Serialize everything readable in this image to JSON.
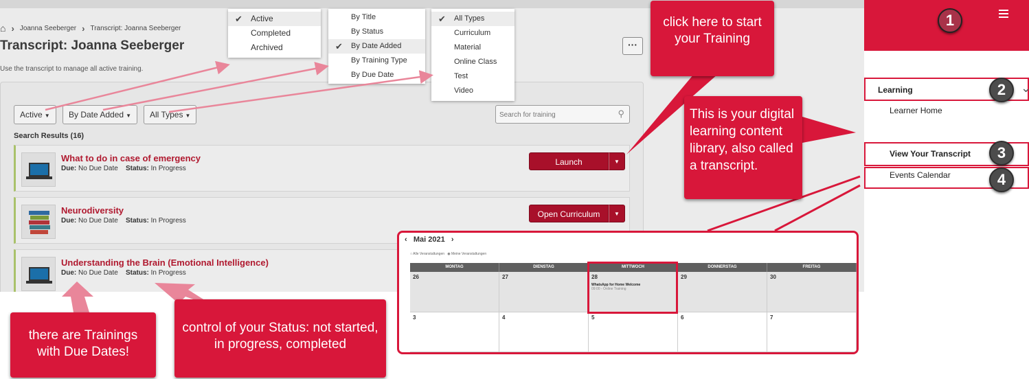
{
  "breadcrumb": {
    "user": "Joanna Seeberger",
    "current": "Transcript: Joanna Seeberger"
  },
  "page": {
    "title": "Transcript: Joanna Seeberger",
    "description": "Use the transcript to manage all active training.",
    "more_label": "···"
  },
  "filters": {
    "status": "Active",
    "sort": "By Date Added",
    "type": "All Types"
  },
  "search": {
    "placeholder": "Search for training"
  },
  "results_title": "Search Results (16)",
  "trainings": [
    {
      "title": "What to do in case of emergency",
      "due_label": "Due:",
      "due": "No Due Date",
      "status_label": "Status:",
      "status": "In Progress",
      "action": "Launch"
    },
    {
      "title": "Neurodiversity",
      "due_label": "Due:",
      "due": "No Due Date",
      "status_label": "Status:",
      "status": "In Progress",
      "action": "Open Curriculum"
    },
    {
      "title": "Understanding the Brain (Emotional Intelligence)",
      "due_label": "Due:",
      "due": "No Due Date",
      "status_label": "Status:",
      "status": "In Progress"
    }
  ],
  "status_menu": {
    "items": [
      "Active",
      "Completed",
      "Archived"
    ],
    "selected": "Active"
  },
  "sort_menu": {
    "items": [
      "By Title",
      "By Status",
      "By Date Added",
      "By Training Type",
      "By Due Date"
    ],
    "selected": "By Date Added"
  },
  "type_menu": {
    "items": [
      "All Types",
      "Curriculum",
      "Material",
      "Online Class",
      "Test",
      "Video"
    ],
    "selected": "All Types"
  },
  "callouts": {
    "launch": "click here to start your Training",
    "library": "This is your digital learning content library, also called a transcript.",
    "due_dates": "there are Trainings with Due Dates!",
    "status": "control of your Status: not started, in progress, completed"
  },
  "sidebar": {
    "badges": [
      "1",
      "2",
      "3",
      "4"
    ],
    "learning": "Learning",
    "learner_home": "Learner Home",
    "view_transcript": "View Your Transcript",
    "events_calendar": "Events Calendar"
  },
  "calendar": {
    "month": "Mai 2021",
    "prev": "‹",
    "next": "›",
    "filter_all": "Alle Veranstaltungen",
    "filter_mine": "Meine Veranstaltungen",
    "weekdays": [
      "MONTAG",
      "DIENSTAG",
      "MITTWOCH",
      "DONNERSTAG",
      "FREITAG"
    ],
    "week1": [
      "26",
      "27",
      "28",
      "29",
      "30"
    ],
    "week2": [
      "3",
      "4",
      "5",
      "6",
      "7"
    ],
    "event_title": "WhatsApp for Home Welcome",
    "event_sub": "09:00 - Online Training"
  },
  "colors": {
    "accent": "#d8173a",
    "launch": "#a8102a",
    "title_red": "#b0192f"
  }
}
